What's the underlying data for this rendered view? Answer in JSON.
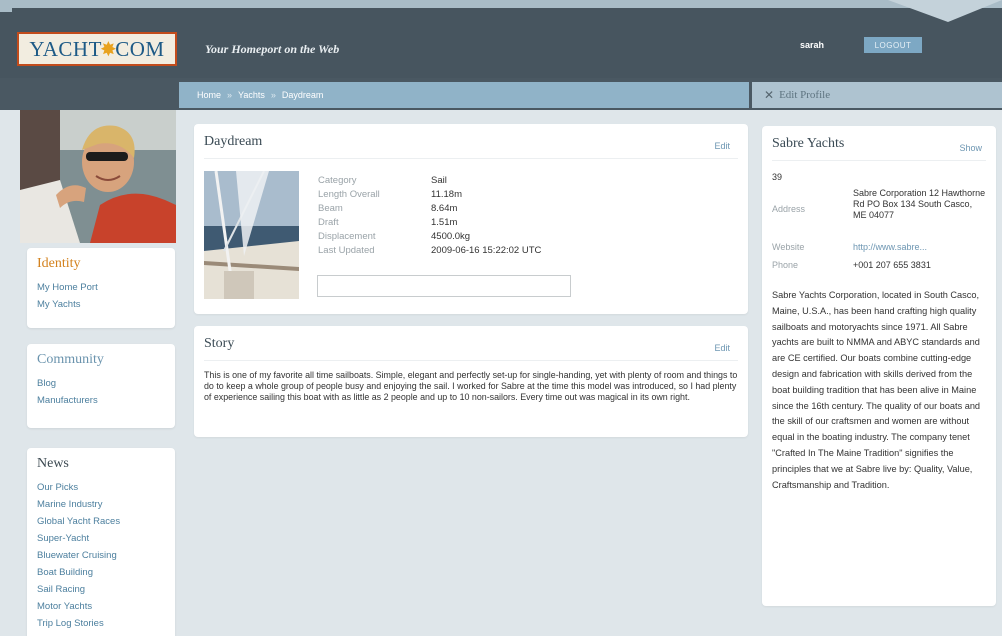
{
  "header": {
    "logo_text_left": "YACHT",
    "logo_text_right": "COM",
    "tagline": "Your Homeport on the Web",
    "username": "sarah",
    "logout_label": "LOGOUT"
  },
  "breadcrumb": {
    "items": [
      "Home",
      "Yachts",
      "Daydream"
    ],
    "separator": "»"
  },
  "edit_profile_label": "Edit Profile",
  "sidebar": {
    "identity": {
      "title": "Identity",
      "links": [
        "My Home Port",
        "My Yachts"
      ]
    },
    "community": {
      "title": "Community",
      "links": [
        "Blog",
        "Manufacturers"
      ]
    },
    "news": {
      "title": "News",
      "links": [
        "Our Picks",
        "Marine Industry",
        "Global Yacht Races",
        "Super-Yacht",
        "Bluewater Cruising",
        "Boat Building",
        "Sail Racing",
        "Motor Yachts",
        "Trip Log Stories"
      ]
    }
  },
  "yacht": {
    "name": "Daydream",
    "edit_label": "Edit",
    "specs": [
      {
        "label": "Category",
        "value": "Sail"
      },
      {
        "label": "Length Overall",
        "value": "11.18m"
      },
      {
        "label": "Beam",
        "value": "8.64m"
      },
      {
        "label": "Draft",
        "value": "1.51m"
      },
      {
        "label": "Displacement",
        "value": "4500.0kg"
      },
      {
        "label": "Last Updated",
        "value": "2009-06-16 15:22:02 UTC"
      }
    ]
  },
  "story": {
    "title": "Story",
    "edit_label": "Edit",
    "text": "This is one of my favorite all time sailboats. Simple, elegant and perfectly set-up for single-handing, yet with plenty of room and things to do to keep a whole group of people busy and enjoying the sail. I worked for Sabre at the time this model was introduced, so I had plenty of experience sailing this boat with as little as 2 people and up to 10 non-sailors. Every time out was magical in its own right."
  },
  "manufacturer": {
    "name": "Sabre Yachts",
    "show_label": "Show",
    "number": "39",
    "address_label": "Address",
    "address": "Sabre Corporation 12 Hawthorne Rd PO Box 134 South Casco, ME 04077",
    "website_label": "Website",
    "website": "http://www.sabre...",
    "phone_label": "Phone",
    "phone": "+001 207 655 3831",
    "description": "Sabre Yachts Corporation, located in South Casco, Maine, U.S.A., has been hand crafting high quality sailboats and motoryachts since 1971. All Sabre yachts are built to NMMA and ABYC standards and are CE certified. Our boats combine cutting-edge design and fabrication with skills derived from the boat building tradition that has been alive in Maine since the 16th century. The quality of our boats and the skill of our craftsmen and women are without equal in the boating industry. The company tenet \"Crafted In The Maine Tradition\" signifies the principles that we at Sabre live by: Quality, Value, Craftsmanship and Tradition."
  },
  "colors": {
    "header_bg": "#47555f",
    "breadcrumb_bg": "#90b3c8",
    "identity_title": "#d3821e",
    "community_title": "#6a93ad",
    "link": "#4c7f9e",
    "logo_border": "#c24c1c"
  },
  "icons": {
    "edit_profile": "wrench-screwdriver-icon",
    "logo_star": "compass-star-icon"
  }
}
